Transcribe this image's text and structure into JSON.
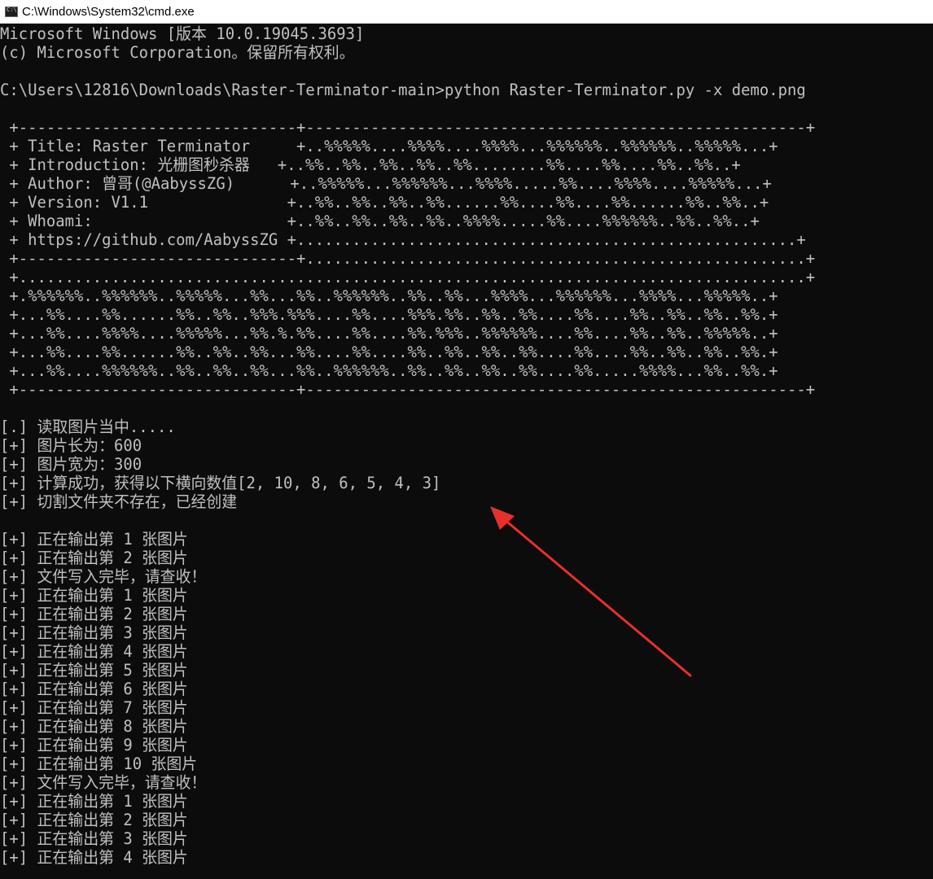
{
  "window": {
    "title": "C:\\Windows\\System32\\cmd.exe",
    "icon": "console-icon"
  },
  "console_lines": [
    {
      "text": "Microsoft Windows [版本 10.0.19045.3693]"
    },
    {
      "text": "(c) Microsoft Corporation。保留所有权利。"
    },
    {
      "text": ""
    },
    {
      "text": "C:\\Users\\12816\\Downloads\\Raster-Terminator-main>python Raster-Terminator.py -x demo.png"
    },
    {
      "text": ""
    },
    {
      "text": " +------------------------------+------------------------------------------------------+"
    },
    {
      "text": " + Title: Raster Terminator     +..%%%%%....%%%%....%%%%...%%%%%%..%%%%%%..%%%%%...+"
    },
    {
      "text": " + Introduction: 光栅图秒杀器   +..%%..%%..%%..%%..%%........%%....%%....%%..%%..+"
    },
    {
      "text": " + Author: 曾哥(@AabyssZG)      +..%%%%%...%%%%%%...%%%%.....%%....%%%%....%%%%%...+"
    },
    {
      "text": " + Version: V1.1               +..%%..%%..%%..%%......%%....%%....%%......%%..%%..+"
    },
    {
      "text": " + Whoami:                     +..%%..%%..%%..%%..%%%%.....%%....%%%%%%..%%..%%..+"
    },
    {
      "text": " + https://github.com/AabyssZG +......................................................+"
    },
    {
      "text": " +------------------------------+......................................................+"
    },
    {
      "text": " +.....................................................................................+"
    },
    {
      "text": " +.%%%%%%..%%%%%%..%%%%%...%%...%%..%%%%%%..%%..%%...%%%%...%%%%%%...%%%%...%%%%%..+"
    },
    {
      "text": " +...%%....%%......%%..%%..%%%.%%%....%%....%%%.%%..%%..%%....%%....%%..%%..%%..%%.+"
    },
    {
      "text": " +...%%....%%%%....%%%%%...%%.%.%%....%%....%%.%%%..%%%%%%....%%....%%..%%..%%%%%..+"
    },
    {
      "text": " +...%%....%%......%%..%%..%%...%%....%%....%%..%%..%%..%%....%%....%%..%%..%%..%%.+"
    },
    {
      "text": " +...%%....%%%%%%..%%..%%..%%...%%..%%%%%%..%%..%%..%%..%%....%%.....%%%%...%%..%%.+"
    },
    {
      "text": " +------------------------------+------------------------------------------------------+"
    },
    {
      "text": ""
    },
    {
      "text": "[.] 读取图片当中....."
    },
    {
      "text": "[+] 图片长为：600"
    },
    {
      "text": "[+] 图片宽为：300"
    },
    {
      "text": "[+] 计算成功，获得以下横向数值[2, 10, 8, 6, 5, 4, 3]"
    },
    {
      "text": "[+] 切割文件夹不存在，已经创建"
    },
    {
      "text": ""
    },
    {
      "text": "[+] 正在输出第 1 张图片"
    },
    {
      "text": "[+] 正在输出第 2 张图片"
    },
    {
      "text": "[+] 文件写入完毕，请查收！"
    },
    {
      "text": "[+] 正在输出第 1 张图片"
    },
    {
      "text": "[+] 正在输出第 2 张图片"
    },
    {
      "text": "[+] 正在输出第 3 张图片"
    },
    {
      "text": "[+] 正在输出第 4 张图片"
    },
    {
      "text": "[+] 正在输出第 5 张图片"
    },
    {
      "text": "[+] 正在输出第 6 张图片"
    },
    {
      "text": "[+] 正在输出第 7 张图片"
    },
    {
      "text": "[+] 正在输出第 8 张图片"
    },
    {
      "text": "[+] 正在输出第 9 张图片"
    },
    {
      "text": "[+] 正在输出第 10 张图片"
    },
    {
      "text": "[+] 文件写入完毕，请查收！"
    },
    {
      "text": "[+] 正在输出第 1 张图片"
    },
    {
      "text": "[+] 正在输出第 2 张图片"
    },
    {
      "text": "[+] 正在输出第 3 张图片"
    },
    {
      "text": "[+] 正在输出第 4 张图片"
    }
  ],
  "annotation": {
    "arrow_color": "#e8302a"
  },
  "colors": {
    "console_bg": "#0c0c0c",
    "console_fg": "#c0c0c0",
    "titlebar_bg": "#ffffff"
  }
}
